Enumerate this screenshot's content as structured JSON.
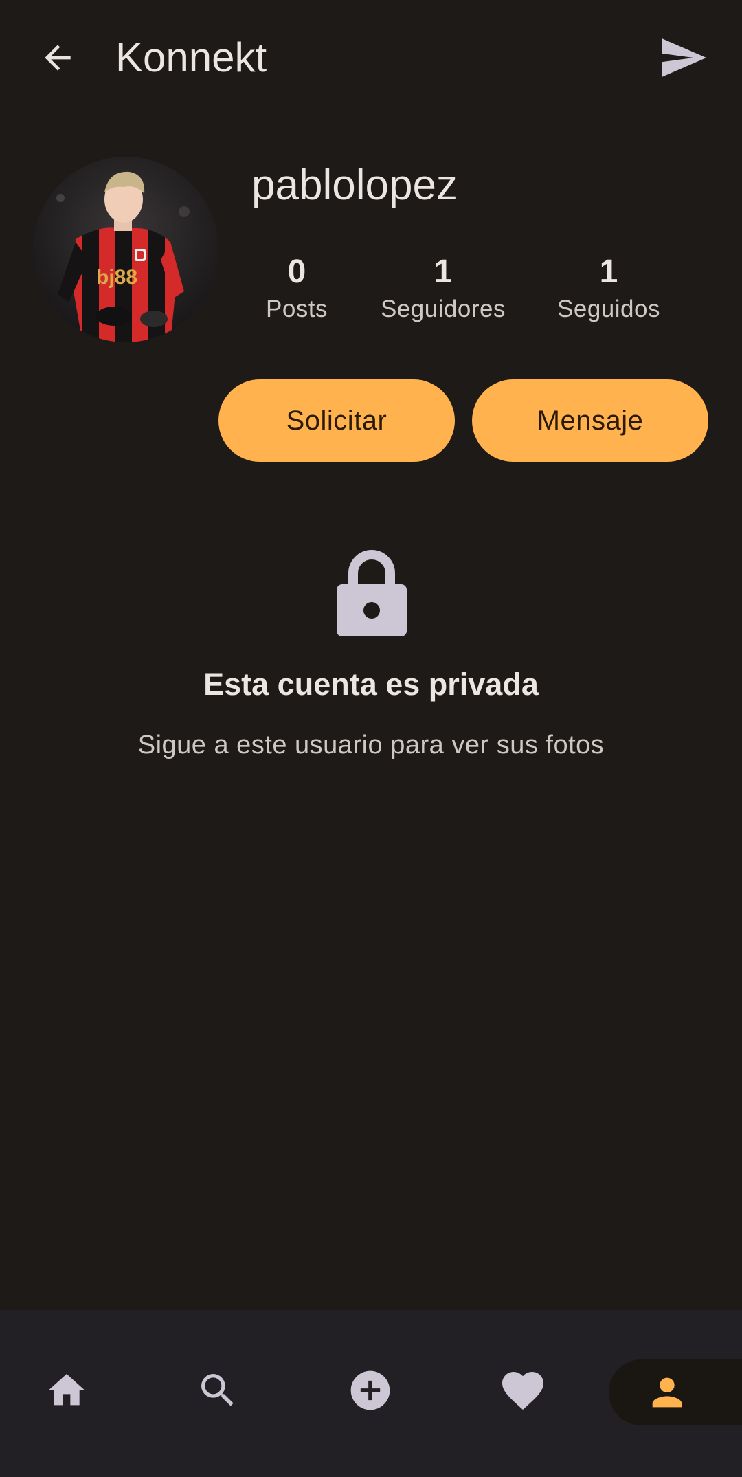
{
  "header": {
    "title": "Konnekt",
    "back_icon": "arrow-back-icon",
    "send_icon": "send-icon"
  },
  "profile": {
    "username": "pablolopez",
    "stats": {
      "posts_value": "0",
      "posts_label": "Posts",
      "followers_value": "1",
      "followers_label": "Seguidores",
      "following_value": "1",
      "following_label": "Seguidos"
    },
    "request_button": "Solicitar",
    "message_button": "Mensaje"
  },
  "private_notice": {
    "icon": "lock-icon",
    "title": "Esta cuenta es privada",
    "subtitle": "Sigue a este usuario para ver sus fotos"
  },
  "bottom_nav": {
    "items": [
      "home-icon",
      "search-icon",
      "add-circle-icon",
      "heart-icon",
      "person-icon"
    ],
    "active": "person-icon"
  },
  "colors": {
    "background": "#1e1a18",
    "accent": "#ffb24d",
    "nav_background": "#221f25",
    "icon": "#cdc6d4"
  }
}
